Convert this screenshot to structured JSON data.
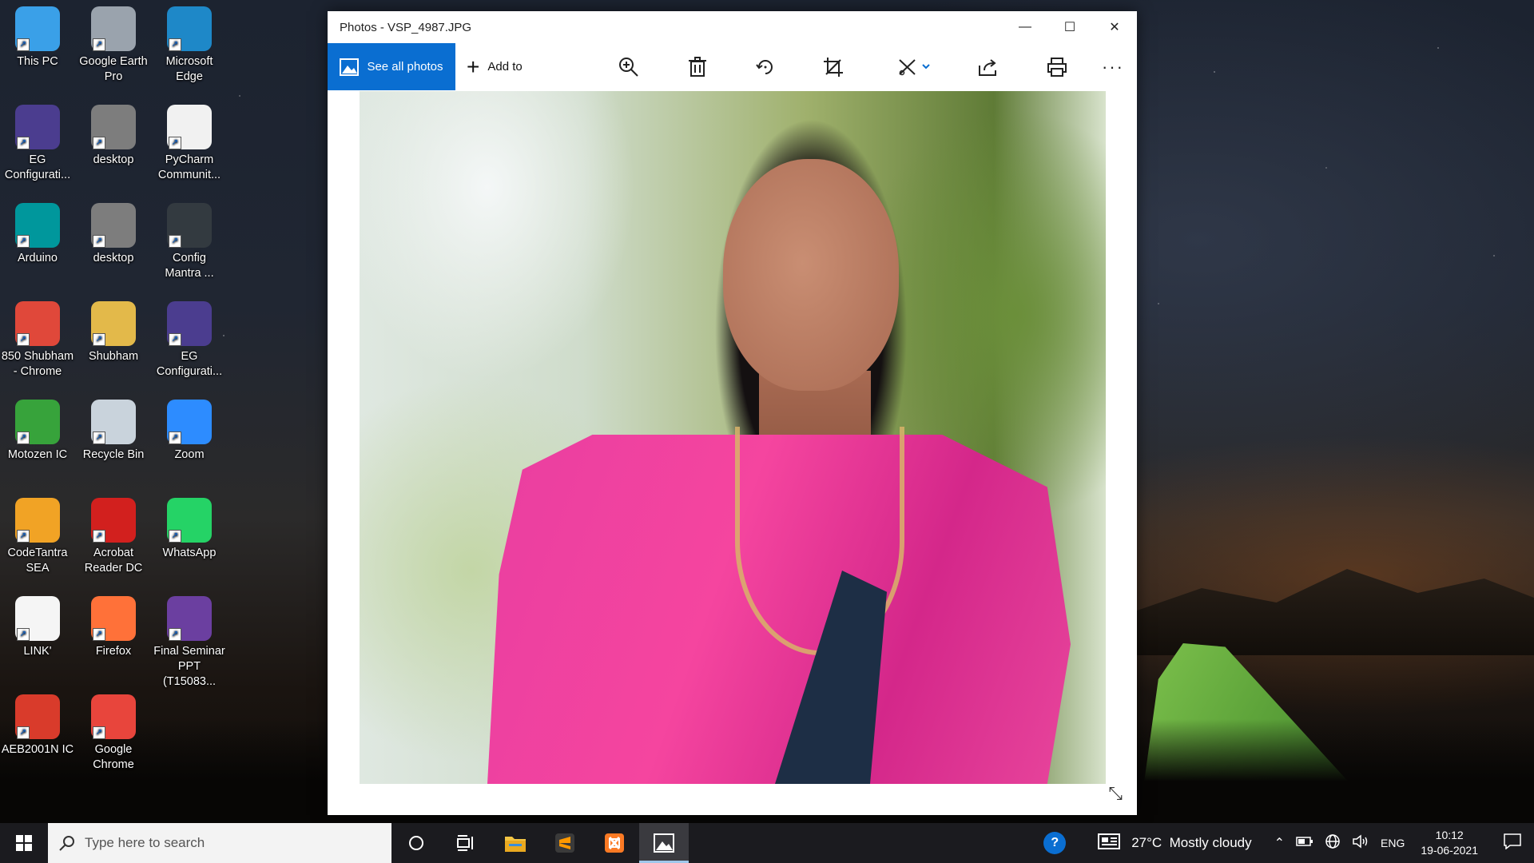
{
  "desktop": {
    "icons": [
      {
        "label1": "This PC",
        "label2": "",
        "icon": "this-pc-icon",
        "color": "#3aa0e8"
      },
      {
        "label1": "Google Earth",
        "label2": "Pro",
        "icon": "google-earth-pro-icon",
        "color": "#9aa3ad"
      },
      {
        "label1": "Microsoft",
        "label2": "Edge",
        "icon": "edge-icon",
        "color": "#1e88c8"
      },
      {
        "label1": "EG",
        "label2": "Configurati...",
        "icon": "eg-config-icon",
        "color": "#4b3d8f"
      },
      {
        "label1": "desktop",
        "label2": "",
        "icon": "desktop-file-icon",
        "color": "#7d7d7d"
      },
      {
        "label1": "PyCharm",
        "label2": "Communit...",
        "icon": "pycharm-file-icon",
        "color": "#f1f1f1"
      },
      {
        "label1": "Arduino",
        "label2": "",
        "icon": "arduino-icon",
        "color": "#00979c"
      },
      {
        "label1": "desktop",
        "label2": "",
        "icon": "desktop-file-icon",
        "color": "#7d7d7d"
      },
      {
        "label1": "Config",
        "label2": "Mantra ...",
        "icon": "config-mantra-icon",
        "color": "#333a40"
      },
      {
        "label1": "850 Shubham",
        "label2": "- Chrome",
        "icon": "chrome-profile-icon",
        "color": "#e0483a"
      },
      {
        "label1": "Shubham",
        "label2": "",
        "icon": "user-folder-icon",
        "color": "#e3b94a"
      },
      {
        "label1": "EG",
        "label2": "Configurati...",
        "icon": "eg-config-icon",
        "color": "#4b3d8f"
      },
      {
        "label1": "Motozen IC",
        "label2": "",
        "icon": "motozen-icon",
        "color": "#37a33b"
      },
      {
        "label1": "Recycle Bin",
        "label2": "",
        "icon": "recycle-bin-icon",
        "color": "#c9d3dc"
      },
      {
        "label1": "Zoom",
        "label2": "",
        "icon": "zoom-icon",
        "color": "#2d8cff"
      },
      {
        "label1": "CodeTantra",
        "label2": "SEA",
        "icon": "codetantra-icon",
        "color": "#f1a325"
      },
      {
        "label1": "Acrobat",
        "label2": "Reader DC",
        "icon": "acrobat-icon",
        "color": "#d2201e"
      },
      {
        "label1": "WhatsApp",
        "label2": "",
        "icon": "whatsapp-icon",
        "color": "#25d366"
      },
      {
        "label1": "LINK'",
        "label2": "",
        "icon": "text-file-icon",
        "color": "#f5f5f5"
      },
      {
        "label1": "Firefox",
        "label2": "",
        "icon": "firefox-icon",
        "color": "#ff7139"
      },
      {
        "label1": "Final Seminar",
        "label2": "PPT (T15083...",
        "icon": "ppt-file-icon",
        "color": "#6b3fa0"
      },
      {
        "label1": "AEB2001N IC",
        "label2": "",
        "icon": "aeb-ic-icon",
        "color": "#d93b2b"
      },
      {
        "label1": "Google",
        "label2": "Chrome",
        "icon": "chrome-icon",
        "color": "#e8453c"
      }
    ]
  },
  "window": {
    "title": "Photos - VSP_4987.JPG",
    "see_all_label": "See all photos",
    "add_to_label": "Add to"
  },
  "taskbar": {
    "search_placeholder": "Type here to search",
    "weather": "27°C  Mostly cloudy",
    "language": "ENG",
    "time": "10:12",
    "date": "19-06-2021"
  }
}
